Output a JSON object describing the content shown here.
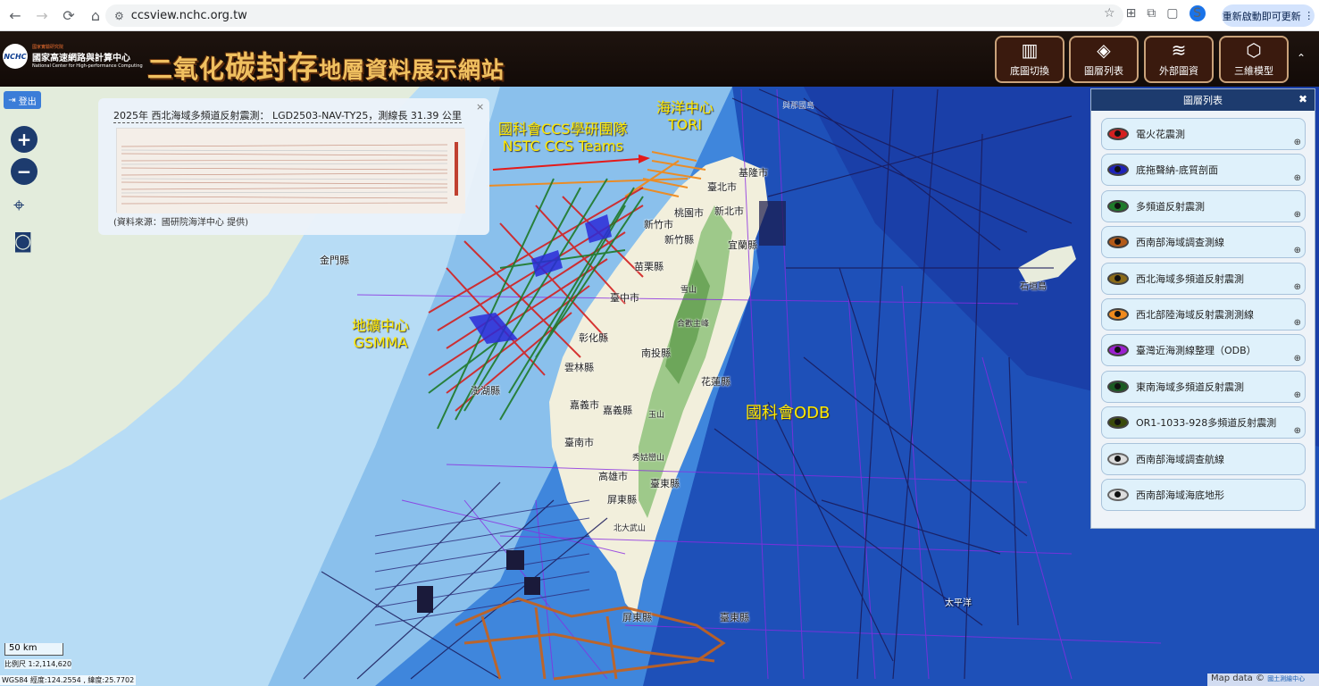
{
  "browser": {
    "url": "ccsview.nchc.org.tw",
    "update_btn": "重新啟動即可更新",
    "profile": "S"
  },
  "header": {
    "logo_small": "國家實驗研究院",
    "logo_main": "國家高速網路與計算中心",
    "logo_en": "National Center for High-performance Computing",
    "logo_abbr": "NCHC",
    "title_1": "二氧化",
    "title_2": "碳封存",
    "title_3": "地層資料展示網站",
    "buttons": [
      {
        "label": "底圖切換",
        "icon": "map-icon"
      },
      {
        "label": "圖層列表",
        "icon": "layers-icon"
      },
      {
        "label": "外部圖資",
        "icon": "external-layers-icon"
      },
      {
        "label": "三維模型",
        "icon": "cubes-icon"
      }
    ]
  },
  "controls": {
    "logout": "登出"
  },
  "seismic": {
    "title": "2025年 西北海域多頻道反射震測： LGD2503-NAV-TY25，測線長 31.39 公里",
    "source": "(資料來源：國研院海洋中心 提供)"
  },
  "layer_panel": {
    "title": "圖層列表",
    "items": [
      {
        "label": "電火花震測",
        "color": "#d42020",
        "visible": true
      },
      {
        "label": "底拖聲納-底質剖面",
        "color": "#1e22b8",
        "visible": true
      },
      {
        "label": "多頻道反射震測",
        "color": "#1e7a2a",
        "visible": true
      },
      {
        "label": "西南部海域調查測線",
        "color": "#b35a18",
        "visible": true
      },
      {
        "label": "西北海域多頻道反射震測",
        "color": "#8a6a18",
        "visible": true
      },
      {
        "label": "西北部陸海域反射震測測線",
        "color": "#f08a1c",
        "visible": true
      },
      {
        "label": "臺灣近海測線整理（ODB）",
        "color": "#9b1fd0",
        "visible": true
      },
      {
        "label": "東南海域多頻道反射震測",
        "color": "#1a5a22",
        "visible": true
      },
      {
        "label": "OR1-1033-928多頻道反射震測",
        "color": "#3a4a0a",
        "visible": true
      },
      {
        "label": "西南部海域調查航線",
        "color": "#777777",
        "visible": false
      },
      {
        "label": "西南部海域海底地形",
        "color": "#777777",
        "visible": false
      }
    ]
  },
  "map": {
    "annotations": {
      "nstc_1": "國科會CCS學研團隊",
      "nstc_2": "NSTC CCS Teams",
      "tori_1": "海洋中心",
      "tori_2": "TORI",
      "gsmma_1": "地礦中心",
      "gsmma_2": "GSMMA",
      "odb": "國科會ODB"
    },
    "labels": [
      "金門縣",
      "基隆市",
      "臺北市",
      "桃園市",
      "新北市",
      "新竹市",
      "新竹縣",
      "宜蘭縣",
      "苗栗縣",
      "雪山",
      "臺中市",
      "合歡主峰",
      "彰化縣",
      "南投縣",
      "雲林縣",
      "花蓮縣",
      "嘉義市",
      "嘉義縣",
      "澎湖縣",
      "玉山",
      "臺南市",
      "秀姑巒山",
      "高雄市",
      "臺東縣",
      "屏東縣",
      "北大武山",
      "屏東縣",
      "臺東縣",
      "石垣島",
      "太平洋",
      "與那國島"
    ],
    "scale_bar": "50 km",
    "scale_ratio": "比例尺 1:2,114,620",
    "coords": "WGS84 經度:124.2554 , 緯度:25.7702",
    "attribution": "Map data ©",
    "attribution_src": "國土測繪中心"
  }
}
